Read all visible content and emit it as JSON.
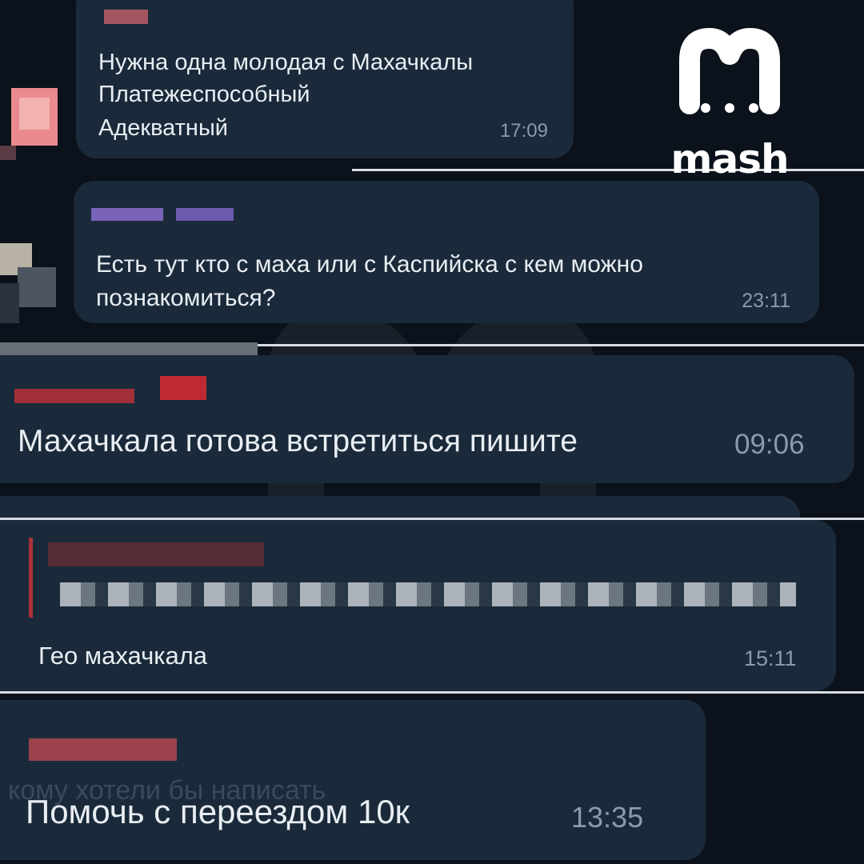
{
  "brand": {
    "name": "mash"
  },
  "messages": [
    {
      "text_lines": [
        "Нужна одна молодая с Махачкалы",
        "Платежеспособный",
        "Адекватный"
      ],
      "time": "17:09"
    },
    {
      "text_lines": [
        "Есть тут кто с маха или с Каспийска с кем можно",
        "познакомиться?"
      ],
      "time": "23:11"
    },
    {
      "text": "Махачкала готова встретиться пишите",
      "time": "09:06"
    },
    {
      "text": "Гео махачкала",
      "time": "15:11"
    },
    {
      "text": "Помочь с переездом 10к",
      "time": "13:35"
    }
  ],
  "faded_input_hint": "кому хотели бы написать",
  "colors": {
    "background": "#0b121b",
    "bubble": "#1b2a3a",
    "text": "#e9eef3",
    "time": "#8a9bab",
    "divider": "#d9dde2"
  }
}
